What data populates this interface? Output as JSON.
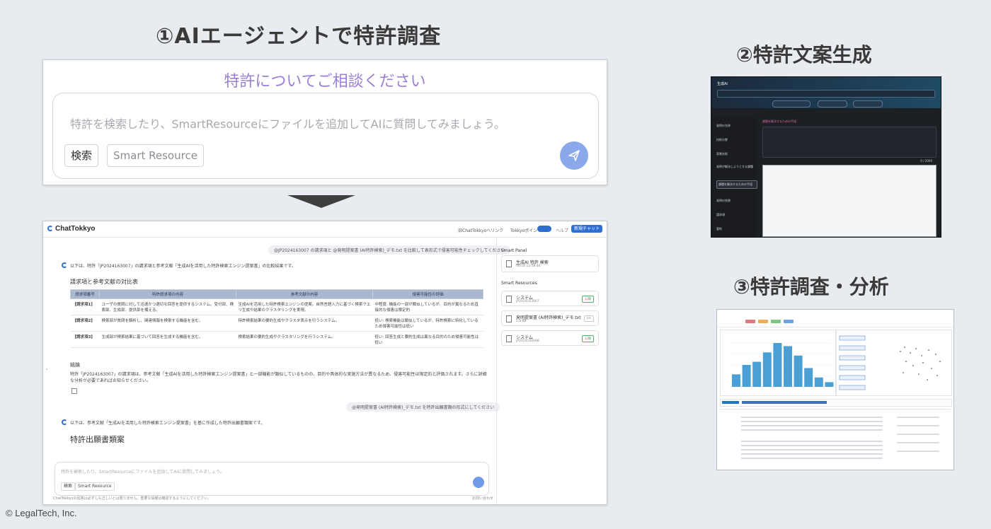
{
  "titles": {
    "step1": "①AIエージェントで特許調査",
    "step2": "②特許文案生成",
    "step3": "③特許調査・分析"
  },
  "copyright": "© LegalTech, Inc.",
  "search_panel": {
    "hero": "特許についてご相談ください",
    "placeholder": "特許を検索したり、SmartResourceにファイルを追加してAIに質問してみましょう。",
    "chip_search": "検索",
    "chip_smart_resource": "Smart Resource"
  },
  "chat_app": {
    "logo": "ChatTokkyo",
    "top_link": "旧ChatTokkyoへリンク",
    "top_points": "Tokkyoポイント",
    "top_help": "ヘルプ",
    "top_new": "新規チャット",
    "user_msg_1": "@JP2024163007 の請求項と @発明提案書 (AI特許検索)_デモ.txt を比較して表形式で侵害可能性チェックしてください",
    "ai_msg_1": "以下は、特許「JP2024163007」の請求項と参考文献「生成AIを活用した特許検索エンジン提案書」の比較結果です。",
    "table_heading": "請求項と参考文献の対比表",
    "table_headers": [
      "請求項番号",
      "特許請求項の内容",
      "参考文献の内容",
      "侵害可能性の評価"
    ],
    "table_rows": [
      [
        "【請求項1】",
        "ユーザの質問に対して迅速かつ適切な回答を提供するシステム。受付部、検索部、生成部、提供部を備える。",
        "生成AIを活用した特許検索エンジンの提案。自然言語入力に基づく検索クエリ生成や結果のクラスタリングを実現。",
        "中程度: 機能の一部が類似しているが、目的が異なるため直接的な侵害は限定的"
      ],
      [
        "【請求項2】",
        "検索部が質問を解析し、関連情報を検索する機能を含む。",
        "特許検索結果の要約生成やクラスタ表示を行うシステム。",
        "低い: 検索機能は類似しているが、特許検索に特化しているため侵害可能性は低い"
      ],
      [
        "【請求項3】",
        "生成部が検索結果に基づいて回答を生成する機能を含む。",
        "検索結果の要約生成やクラスタリングを行うシステム。",
        "低い: 回答生成と要約生成は異なる目的のため侵害可能性は低い"
      ]
    ],
    "conclusion_heading": "結論",
    "conclusion": "特許「JP2024163007」の請求項は、参考文献「生成AIを活用した特許検索エンジン提案書」と一部機能が類似しているものの、目的や具体的な実施方法が異なるため、侵害可能性は限定的と評価されます。さらに詳細な分析が必要であればお知らせください。",
    "user_msg_2": "@発明提案書 (AI特許検索)_デモ.txt を特許出願書類の形式にしてください",
    "ai_msg_2": "以下は、参考文献「生成AIを活用した特許検索エンジン提案書」を基に作成した特許出願書類案です。",
    "draft_heading": "特許出願書類案",
    "input_placeholder": "特許を検索したり、SmartResourceにファイルを追加してAIに質問してみましょう。",
    "chip_search": "検索",
    "chip_smart_resource": "Smart Resource",
    "footer": "ChatTokkyoの回答は必ずしも正しいとは限りません。重要な情報は確認するようにしてください。",
    "footer_right": "お問い合わせ",
    "side_panel_title": "Smart Panel",
    "side_panel_card": "生成AI 特許 検索",
    "side_panel_card_sub": "06/18 12:58:46",
    "side_resources_title": "Smart Resources",
    "resources": [
      {
        "name": "システム",
        "sub": "JP2024163007",
        "badge": "公報"
      },
      {
        "name": "発明提案書 (AI特許検索)_デモ.txt",
        "sub": "2.8 KB",
        "badge": "txt"
      },
      {
        "name": "システム",
        "sub": "JP2024166008",
        "badge": "公報"
      }
    ]
  },
  "generator": {
    "title": "生成AI",
    "nav": [
      "発明の名称",
      "技術分野",
      "背景技術",
      "発明が解決しようとする課題",
      "課題を解決するための手段",
      "発明の効果",
      "請求項",
      "要約"
    ],
    "section": "課題を解決するための手段",
    "counter": "0 / 2000"
  },
  "analysis": {
    "chart_title": "出願件数推移",
    "bar_values": [
      8,
      14,
      16,
      22,
      28,
      26,
      20,
      12,
      6,
      3
    ]
  },
  "colors": {
    "accent_blue": "#2f6fd0",
    "hero_purple": "#9b7fd4",
    "chart_blue": "#4a9fd4"
  }
}
